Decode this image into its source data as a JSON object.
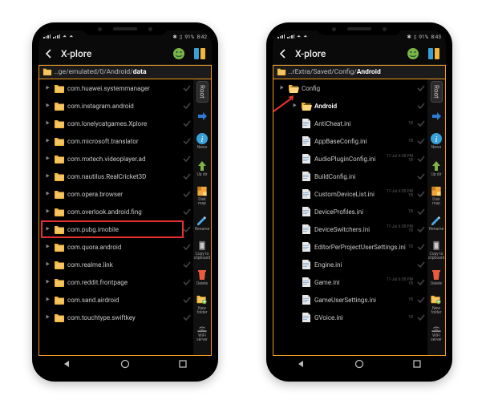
{
  "phone_left": {
    "status": {
      "battery": "91%",
      "time": "8:42"
    },
    "app_title": "X-plore",
    "breadcrumb_prefix": "…ge/emulated/0/Android/",
    "breadcrumb_current": "data",
    "root_tab": "Root",
    "side_tools": {
      "news": "News",
      "updir": "Up dir",
      "diskmap": "Disk map",
      "rename": "Rename",
      "copyclip": "Copy to clipboard",
      "delete": "Delete",
      "newfolder": "New folder",
      "wifi": "WiFi server"
    },
    "rows": [
      {
        "name": "com.huawei.systemmanager",
        "highlight": false
      },
      {
        "name": "com.instagram.android",
        "highlight": false
      },
      {
        "name": "com.lonelycatgames.Xplore",
        "highlight": false
      },
      {
        "name": "com.microsoft.translator",
        "highlight": false
      },
      {
        "name": "com.mxtech.videoplayer.ad",
        "highlight": false
      },
      {
        "name": "com.nautilus.RealCricket3D",
        "highlight": false
      },
      {
        "name": "com.opera.browser",
        "highlight": false
      },
      {
        "name": "com.overlook.android.fing",
        "highlight": false
      },
      {
        "name": "com.pubg.imobile",
        "highlight": true
      },
      {
        "name": "com.quora.android",
        "highlight": false
      },
      {
        "name": "com.realme.link",
        "highlight": false
      },
      {
        "name": "com.reddit.frontpage",
        "highlight": false
      },
      {
        "name": "com.sand.airdroid",
        "highlight": false
      },
      {
        "name": "com.touchtype.swiftkey",
        "highlight": false
      }
    ]
  },
  "phone_right": {
    "status": {
      "battery": "91%",
      "time": "8:43"
    },
    "app_title": "X-plore",
    "breadcrumb_prefix": "…rExtra/Saved/Config/",
    "breadcrumb_current": "Android",
    "root_tab": "Root",
    "side_tools": {
      "news": "News",
      "updir": "Up dir",
      "diskmap": "Disk map",
      "rename": "Rename",
      "copyclip": "Copy to clipboard",
      "delete": "Delete",
      "newfolder": "New folder",
      "wifi": "WiFi server"
    },
    "parent_row": "Config",
    "folder_row": "Android",
    "rows": [
      {
        "name": "AntiCheat.ini",
        "date": "",
        "size": "1B"
      },
      {
        "name": "AppBaseConfig.ini",
        "date": "",
        "size": "1B"
      },
      {
        "name": "AudioPluginConfig.ini",
        "date": "17-Jul 6:38 PM",
        "size": "1B"
      },
      {
        "name": "BuildConfig.ini",
        "date": "",
        "size": ""
      },
      {
        "name": "CustomDeviceList.ini",
        "date": "17-Jul 6:38 PM",
        "size": "1B"
      },
      {
        "name": "DeviceProfiles.ini",
        "date": "",
        "size": "1B"
      },
      {
        "name": "DeviceSwitchers.ini",
        "date": "17-Jul 6:38 PM",
        "size": "1B"
      },
      {
        "name": "EditorPerProjectUserSettings.ini",
        "date": "",
        "size": "1B"
      },
      {
        "name": "Engine.ini",
        "date": "",
        "size": ""
      },
      {
        "name": "Game.ini",
        "date": "17-Jul 6:38 PM",
        "size": "1B"
      },
      {
        "name": "GameUserSettings.ini",
        "date": "",
        "size": "1B"
      },
      {
        "name": "GVoice.ini",
        "date": "",
        "size": "1B"
      }
    ]
  }
}
